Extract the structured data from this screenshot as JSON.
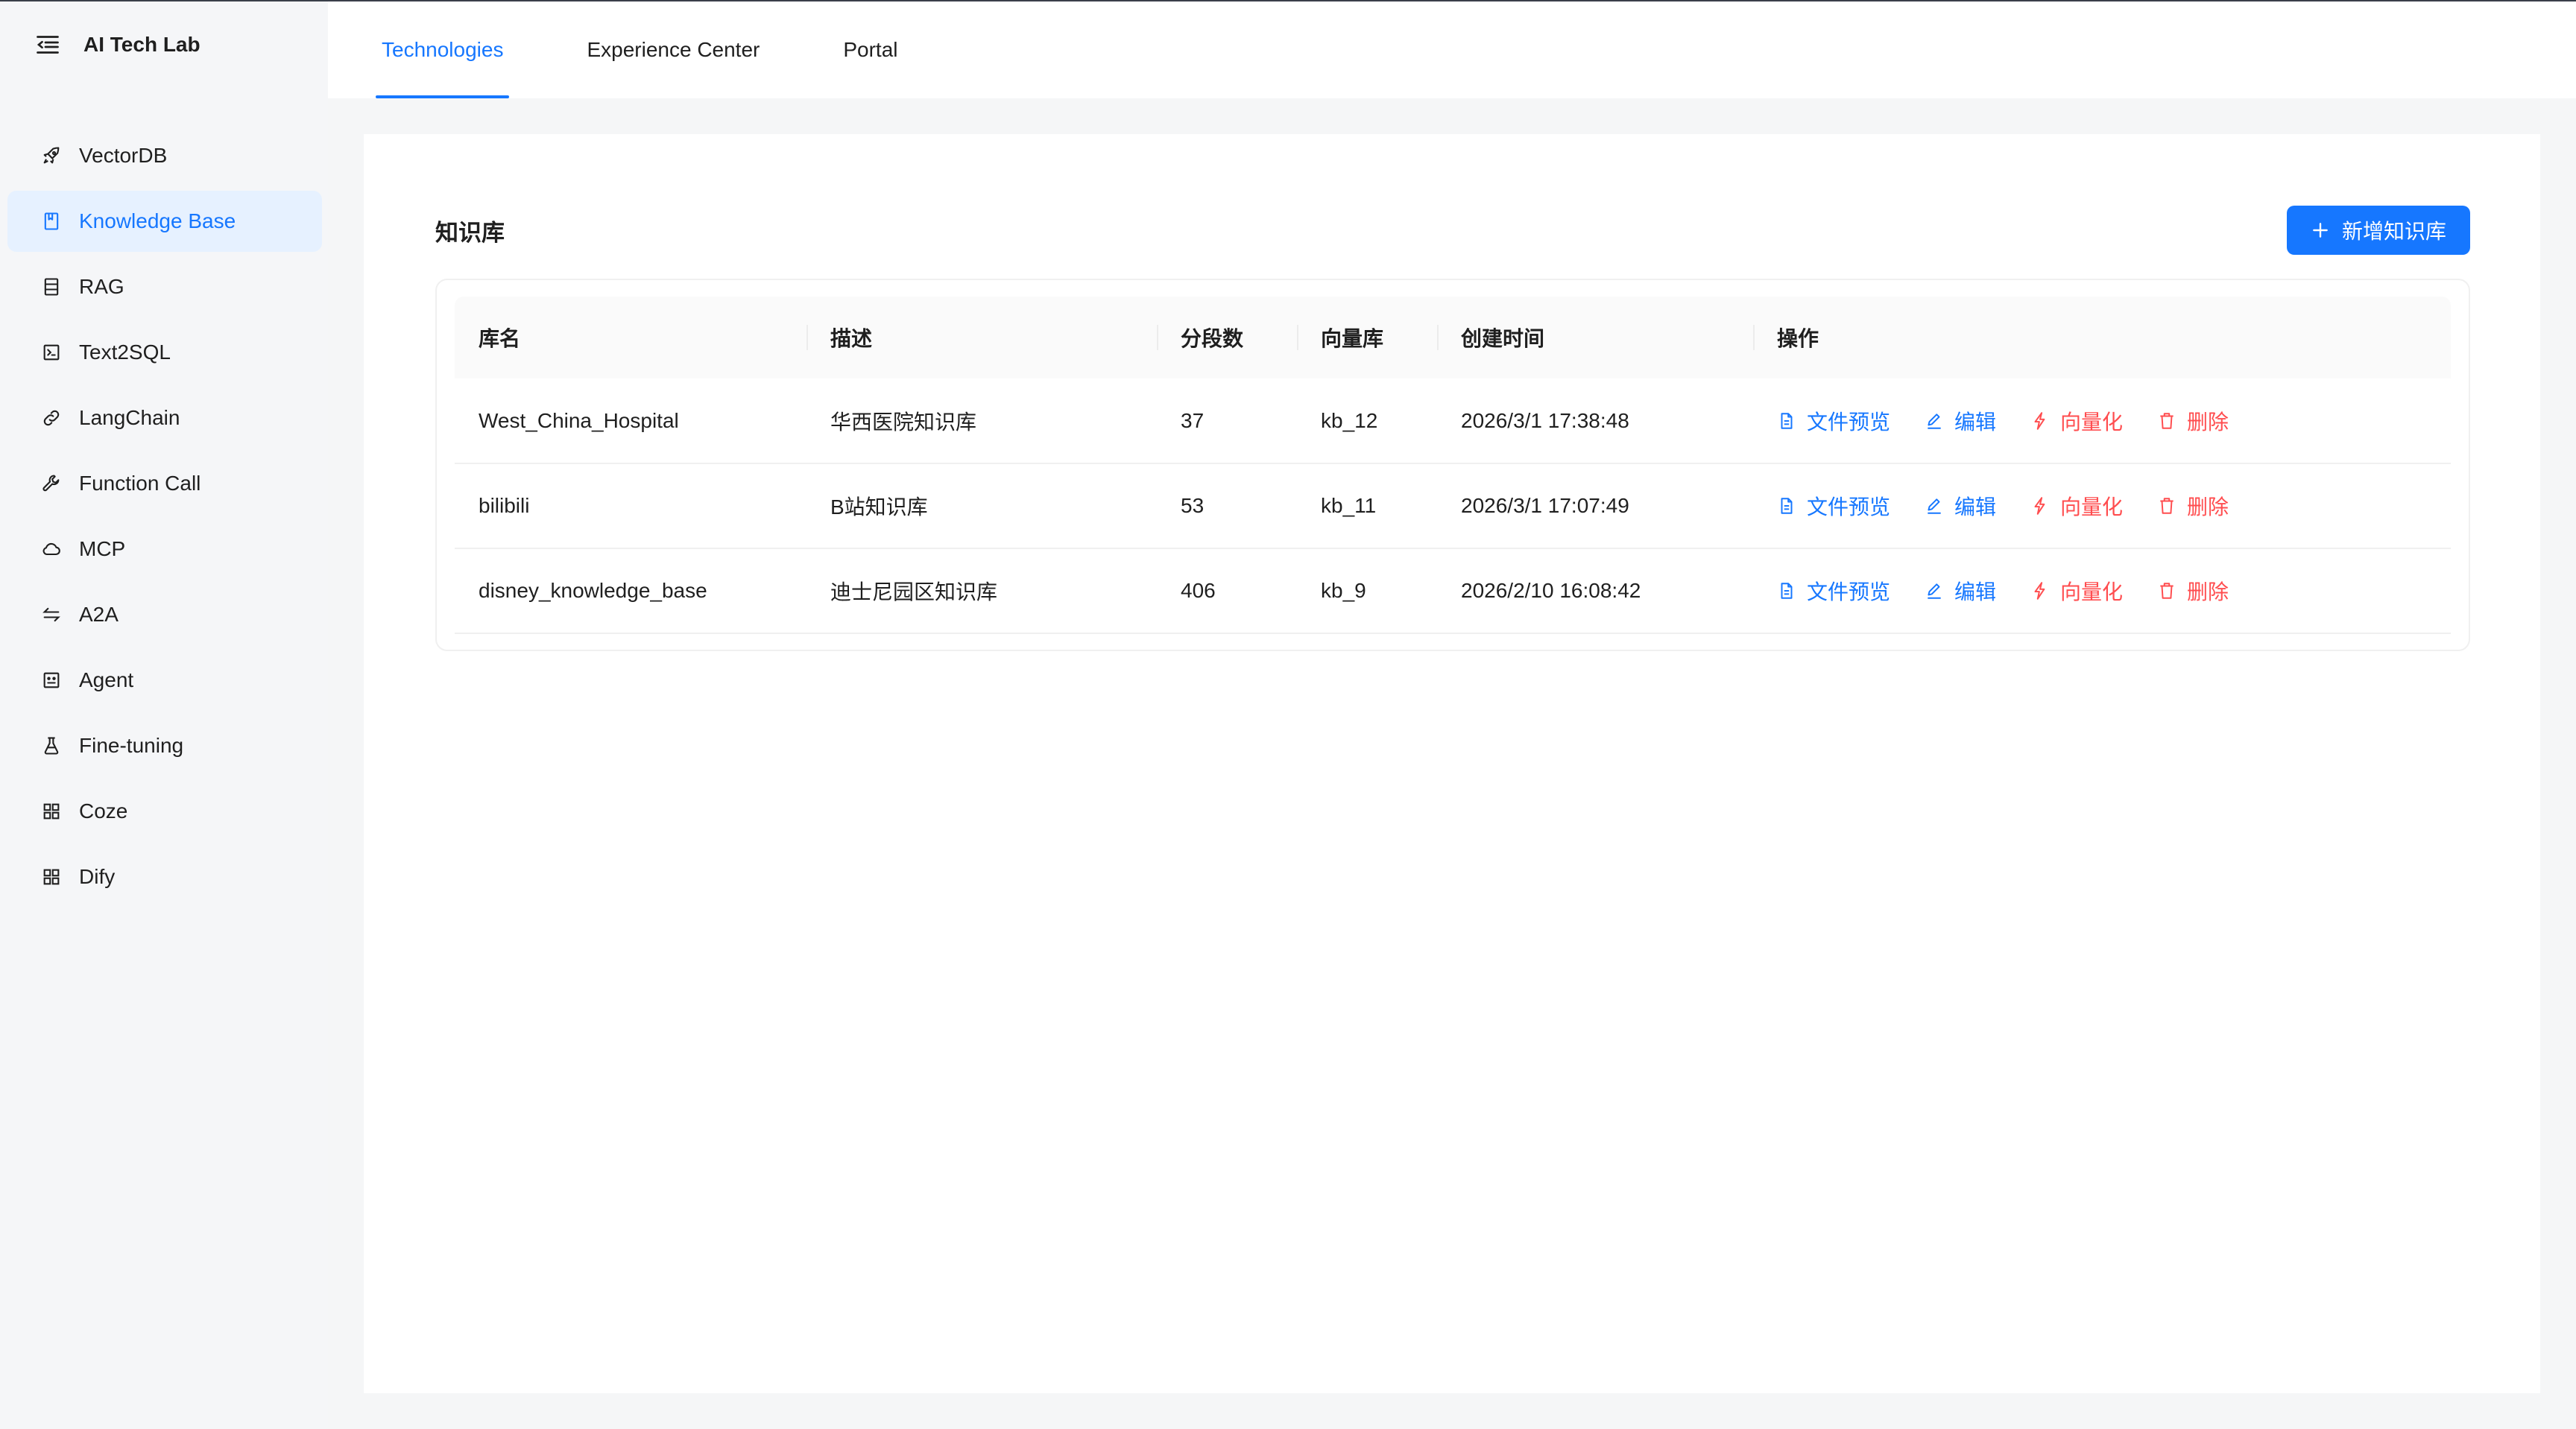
{
  "app": {
    "title": "AI Tech Lab"
  },
  "sidebar": {
    "items": [
      {
        "label": "VectorDB",
        "icon": "rocket-icon",
        "active": false
      },
      {
        "label": "Knowledge Base",
        "icon": "book-icon",
        "active": true
      },
      {
        "label": "RAG",
        "icon": "database-icon",
        "active": false
      },
      {
        "label": "Text2SQL",
        "icon": "code-icon",
        "active": false
      },
      {
        "label": "LangChain",
        "icon": "link-icon",
        "active": false
      },
      {
        "label": "Function Call",
        "icon": "tool-icon",
        "active": false
      },
      {
        "label": "MCP",
        "icon": "cloud-icon",
        "active": false
      },
      {
        "label": "A2A",
        "icon": "swap-icon",
        "active": false
      },
      {
        "label": "Agent",
        "icon": "robot-icon",
        "active": false
      },
      {
        "label": "Fine-tuning",
        "icon": "experiment-icon",
        "active": false
      },
      {
        "label": "Coze",
        "icon": "appstore-icon",
        "active": false
      },
      {
        "label": "Dify",
        "icon": "appstore-icon",
        "active": false
      }
    ]
  },
  "topnav": {
    "tabs": [
      {
        "label": "Technologies",
        "active": true
      },
      {
        "label": "Experience Center",
        "active": false
      },
      {
        "label": "Portal",
        "active": false
      }
    ]
  },
  "main": {
    "title": "知识库",
    "add_button_label": "新增知识库",
    "table": {
      "columns": [
        "库名",
        "描述",
        "分段数",
        "向量库",
        "创建时间",
        "操作"
      ],
      "rows": [
        {
          "name": "West_China_Hospital",
          "description": "华西医院知识库",
          "segments": "37",
          "vector_store": "kb_12",
          "created_at": "2026/3/1 17:38:48"
        },
        {
          "name": "bilibili",
          "description": "B站知识库",
          "segments": "53",
          "vector_store": "kb_11",
          "created_at": "2026/3/1 17:07:49"
        },
        {
          "name": "disney_knowledge_base",
          "description": "迪士尼园区知识库",
          "segments": "406",
          "vector_store": "kb_9",
          "created_at": "2026/2/10 16:08:42"
        }
      ],
      "row_actions": {
        "preview": "文件预览",
        "edit": "编辑",
        "vectorize": "向量化",
        "delete": "删除"
      }
    }
  },
  "colors": {
    "accent": "#1677ff",
    "danger": "#ff4d4f",
    "active_bg": "#e6f1ff",
    "page_bg": "#f5f6f7"
  }
}
